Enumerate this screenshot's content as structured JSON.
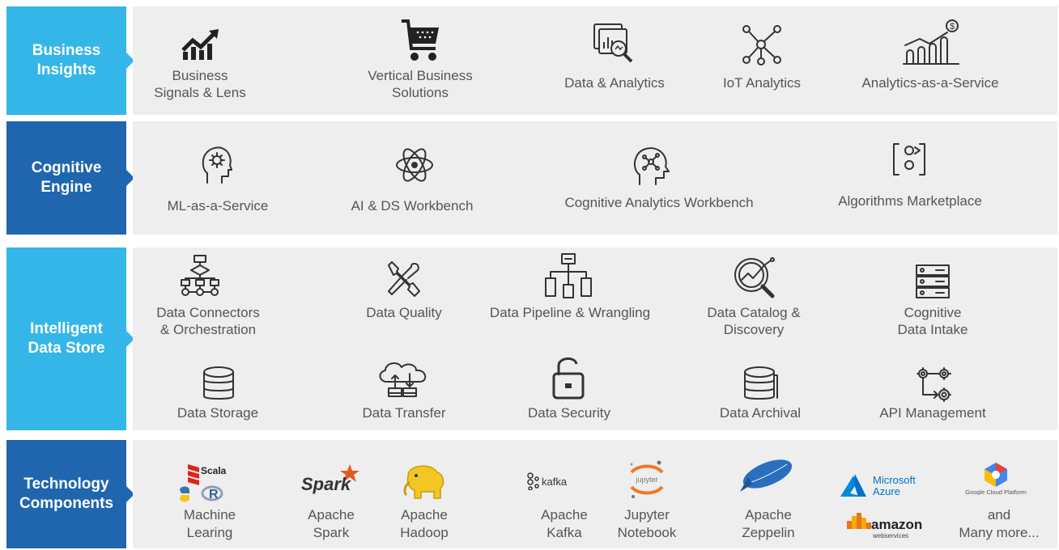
{
  "rows": {
    "business": {
      "label": "Business\nInsights"
    },
    "cognitive": {
      "label": "Cognitive\nEngine"
    },
    "datastore": {
      "label": "Intelligent\nData Store"
    },
    "tech": {
      "label": "Technology\nComponents"
    }
  },
  "business_items": [
    {
      "label": "Business\nSignals & Lens",
      "icon": "growth-chart-icon"
    },
    {
      "label": "Vertical Business\nSolutions",
      "icon": "shopping-cart-icon"
    },
    {
      "label": "Data & Analytics",
      "icon": "analytics-magnifier-icon"
    },
    {
      "label": "IoT Analytics",
      "icon": "network-nodes-icon"
    },
    {
      "label": "Analytics-as-a-Service",
      "icon": "dollar-chart-icon"
    }
  ],
  "cognitive_items": [
    {
      "label": "ML-as-a-Service",
      "icon": "head-gear-icon"
    },
    {
      "label": "AI & DS Workbench",
      "icon": "atom-icon"
    },
    {
      "label": "Cognitive Analytics Workbench",
      "icon": "head-network-icon"
    },
    {
      "label": "Algorithms Marketplace",
      "icon": "algorithm-icon"
    }
  ],
  "datastore_items": [
    {
      "label": "Data Connectors\n& Orchestration",
      "icon": "flowchart-icon"
    },
    {
      "label": "Data Quality",
      "icon": "tools-icon"
    },
    {
      "label": "Data Pipeline & Wrangling",
      "icon": "hierarchy-icon"
    },
    {
      "label": "Data Catalog &\nDiscovery",
      "icon": "search-chart-icon"
    },
    {
      "label": "Cognitive\nData Intake",
      "icon": "server-icon"
    },
    {
      "label": "Data Storage",
      "icon": "database-icon"
    },
    {
      "label": "Data Transfer",
      "icon": "cloud-transfer-icon"
    },
    {
      "label": "Data Security",
      "icon": "lock-icon"
    },
    {
      "label": "Data Archival",
      "icon": "database-archive-icon"
    },
    {
      "label": "API Management",
      "icon": "gears-icon"
    }
  ],
  "tech_items": [
    {
      "label": "Machine\nLearing",
      "logos": [
        "Scala"
      ]
    },
    {
      "label": "Apache\nSpark",
      "logos": [
        "Spark"
      ]
    },
    {
      "label": "Apache\nHadoop"
    },
    {
      "label": "Apache\nKafka",
      "logos": [
        "kafka"
      ]
    },
    {
      "label": "Jupyter\nNotebook",
      "logos": [
        "jupyter"
      ]
    },
    {
      "label": "Apache\nZeppelin"
    },
    {
      "logos": [
        "Microsoft",
        "Azure",
        "amazon",
        "webservices"
      ]
    },
    {
      "label": "and\nMany more...",
      "logos": [
        "Google Cloud Platform"
      ]
    }
  ],
  "colors": {
    "light_blue": "#35b6e8",
    "dark_blue": "#1f66ae",
    "panel": "#eeeeee",
    "text": "#555555"
  }
}
